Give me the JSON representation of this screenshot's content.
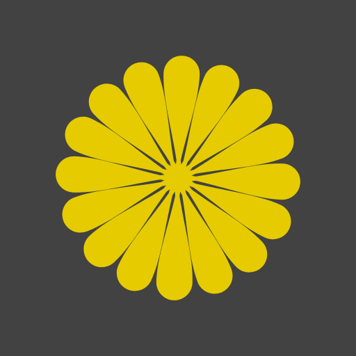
{
  "image": {
    "icon": "yellow-flower-icon",
    "petal_count": 16
  },
  "colors": {
    "background": "#424242",
    "petal": "#E5CB00",
    "center": "#E5CB00"
  }
}
